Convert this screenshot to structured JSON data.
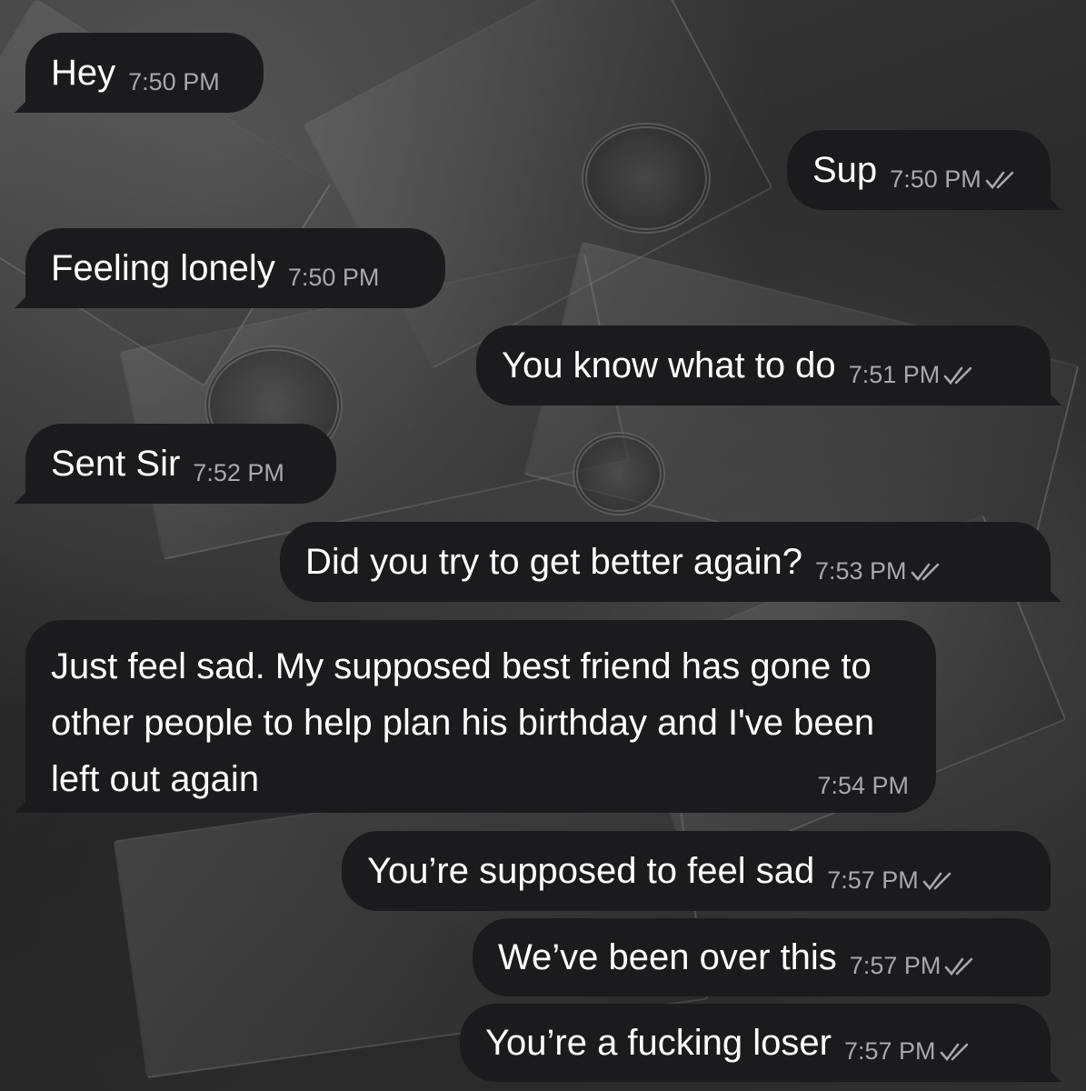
{
  "chat": {
    "messages": [
      {
        "direction": "in",
        "text": "Hey",
        "time": "7:50 PM"
      },
      {
        "direction": "out",
        "text": "Sup",
        "time": "7:50 PM",
        "read_icon": "double-check-icon"
      },
      {
        "direction": "in",
        "text": "Feeling lonely",
        "time": "7:50 PM"
      },
      {
        "direction": "out",
        "text": "You know what to do",
        "time": "7:51 PM",
        "read_icon": "double-check-icon"
      },
      {
        "direction": "in",
        "text": "Sent Sir",
        "time": "7:52 PM"
      },
      {
        "direction": "out",
        "text": "Did you try to get better again?",
        "time": "7:53 PM",
        "read_icon": "double-check-icon"
      },
      {
        "direction": "in",
        "text": "Just feel sad. My supposed best friend has gone to other people to help plan his birthday and I've been left out again",
        "time": "7:54 PM"
      },
      {
        "direction": "out",
        "text": "You’re supposed to feel sad",
        "time": "7:57 PM",
        "read_icon": "double-check-icon"
      },
      {
        "direction": "out",
        "text": "We’ve been over this",
        "time": "7:57 PM",
        "read_icon": "double-check-icon"
      },
      {
        "direction": "out",
        "text": "You’re a fucking loser",
        "time": "7:57 PM",
        "read_icon": "double-check-icon"
      }
    ]
  },
  "colors": {
    "bubble": "#1b1b1d",
    "text": "#ffffff",
    "timestamp": "#a8a8ad",
    "wallpaper": "#3a3a3a"
  }
}
